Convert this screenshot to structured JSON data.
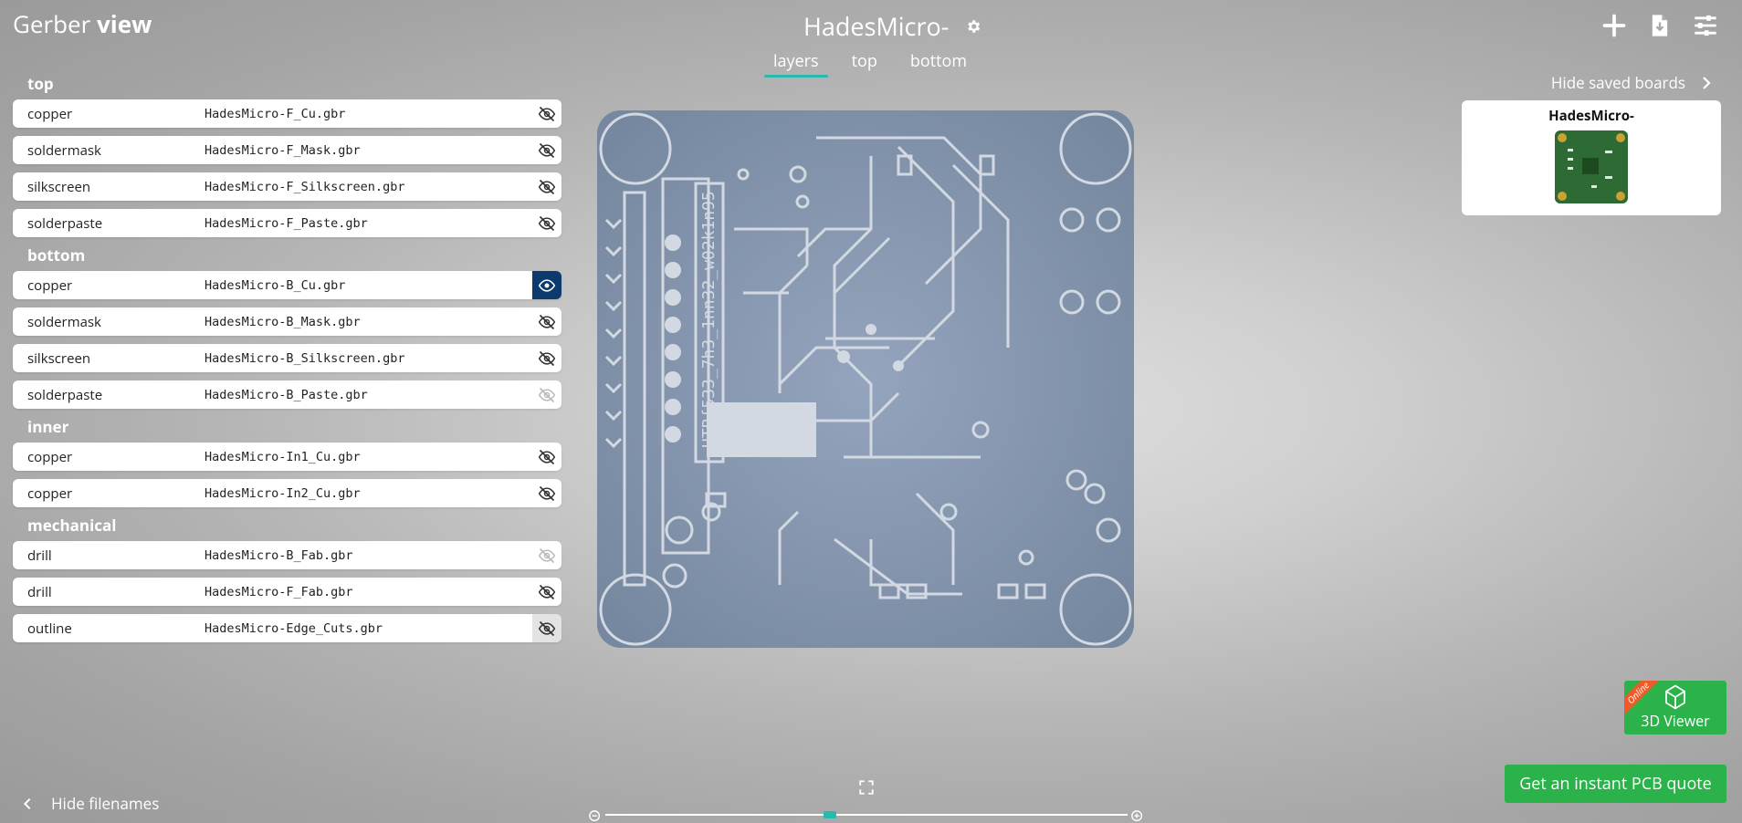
{
  "header": {
    "brand_light": "Gerber ",
    "brand_bold": "view",
    "board_title": "HadesMicro-",
    "tabs": [
      "layers",
      "top",
      "bottom"
    ],
    "active_tab": "layers"
  },
  "top_icons": [
    "add-icon",
    "download-file-icon",
    "sliders-icon"
  ],
  "sections": {
    "top": "top",
    "bottom": "bottom",
    "inner": "inner",
    "mechanical": "mechanical"
  },
  "layers": [
    {
      "type": "copper",
      "file": "HadesMicro-F_Cu.gbr",
      "visible": false
    },
    {
      "type": "soldermask",
      "file": "HadesMicro-F_Mask.gbr",
      "visible": false
    },
    {
      "type": "silkscreen",
      "file": "HadesMicro-F_Silkscreen.gbr",
      "visible": false
    },
    {
      "type": "solderpaste",
      "file": "HadesMicro-F_Paste.gbr",
      "visible": false
    },
    {
      "type": "copper",
      "file": "HadesMicro-B_Cu.gbr",
      "visible": true
    },
    {
      "type": "soldermask",
      "file": "HadesMicro-B_Mask.gbr",
      "visible": false
    },
    {
      "type": "silkscreen",
      "file": "HadesMicro-B_Silkscreen.gbr",
      "visible": false
    },
    {
      "type": "solderpaste",
      "file": "HadesMicro-B_Paste.gbr",
      "visible": false
    },
    {
      "type": "copper",
      "file": "HadesMicro-In1_Cu.gbr",
      "visible": false
    },
    {
      "type": "copper",
      "file": "HadesMicro-In2_Cu.gbr",
      "visible": false
    },
    {
      "type": "drill",
      "file": "HadesMicro-B_Fab.gbr",
      "visible": false
    },
    {
      "type": "drill",
      "file": "HadesMicro-F_Fab.gbr",
      "visible": false
    },
    {
      "type": "outline",
      "file": "HadesMicro-Edge_Cuts.gbr",
      "visible": false
    }
  ],
  "board": {
    "silk_text": "HTB{533_7h3_1nn32_w02k1n95",
    "color": "#7e90ad",
    "trace_color": "#d3d9e2"
  },
  "saved_boards": {
    "toggle_label": "Hide saved boards",
    "items": [
      {
        "name": "HadesMicro-"
      }
    ]
  },
  "viewer3d": {
    "badge": "Online",
    "label": "3D Viewer"
  },
  "quote_button": "Get an instant PCB quote",
  "hide_filenames": "Hide filenames",
  "zoom": {
    "level": 0.43
  },
  "colors": {
    "accent": "#27b8b0",
    "green": "#2cb24a",
    "eye_active": "#0d3a6e",
    "ribbon": "#f05a28"
  }
}
